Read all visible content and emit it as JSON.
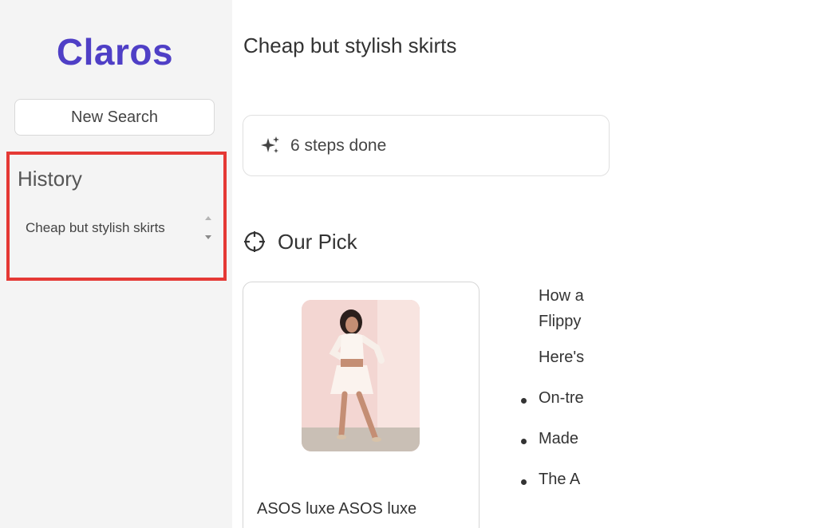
{
  "sidebar": {
    "brand": "Claros",
    "new_search_label": "New Search",
    "history_title": "History",
    "history_items": [
      "Cheap but stylish skirts"
    ]
  },
  "main": {
    "query_title": "Cheap but stylish skirts",
    "steps_label": "6 steps done",
    "our_pick_heading": "Our Pick",
    "product": {
      "name": "ASOS luxe ASOS luxe"
    },
    "description_lines": [
      "How a",
      "Flippy"
    ],
    "heres_text": "Here's",
    "bullets": [
      "On-tre",
      "Made",
      "The A"
    ]
  },
  "colors": {
    "brand": "#4f3fc6",
    "sidebar_bg": "#f4f4f4",
    "highlight_border": "#e53935"
  },
  "icons": {
    "steps": "sparkles-icon",
    "our_pick": "crosshair-icon",
    "scroll": "scroll-arrows-icon"
  }
}
